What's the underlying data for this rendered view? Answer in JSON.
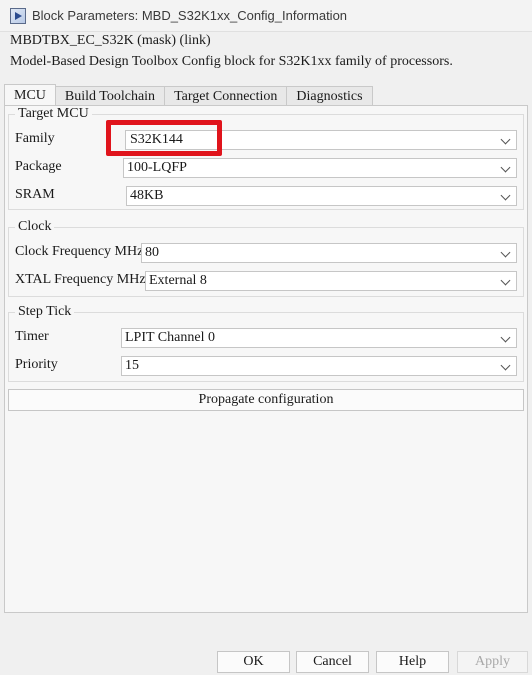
{
  "window": {
    "title": "Block Parameters: MBD_S32K1xx_Config_Information"
  },
  "header": {
    "mask_name": "MBDTBX_EC_S32K (mask) (link)",
    "description": "Model-Based Design Toolbox Config block for S32K1xx family of processors."
  },
  "tabs": [
    {
      "label": "MCU",
      "active": true
    },
    {
      "label": "Build Toolchain",
      "active": false
    },
    {
      "label": "Target Connection",
      "active": false
    },
    {
      "label": "Diagnostics",
      "active": false
    }
  ],
  "target_mcu": {
    "legend": "Target MCU",
    "family_label": "Family",
    "family_value": "S32K144",
    "package_label": "Package",
    "package_value": "100-LQFP",
    "sram_label": "SRAM",
    "sram_value": "48KB"
  },
  "clock": {
    "legend": "Clock",
    "freq_label": "Clock Frequency MHz",
    "freq_value": "80",
    "xtal_label": "XTAL Frequency MHz",
    "xtal_value": "External 8"
  },
  "step_tick": {
    "legend": "Step Tick",
    "timer_label": "Timer",
    "timer_value": "LPIT Channel 0",
    "priority_label": "Priority",
    "priority_value": "15"
  },
  "propagate_label": "Propagate configuration",
  "footer": {
    "ok": "OK",
    "cancel": "Cancel",
    "help": "Help",
    "apply": "Apply"
  },
  "colors": {
    "highlight": "#e0141c",
    "dialog_bg": "#f0f0f0",
    "panel_bg": "#f7f7f7"
  }
}
